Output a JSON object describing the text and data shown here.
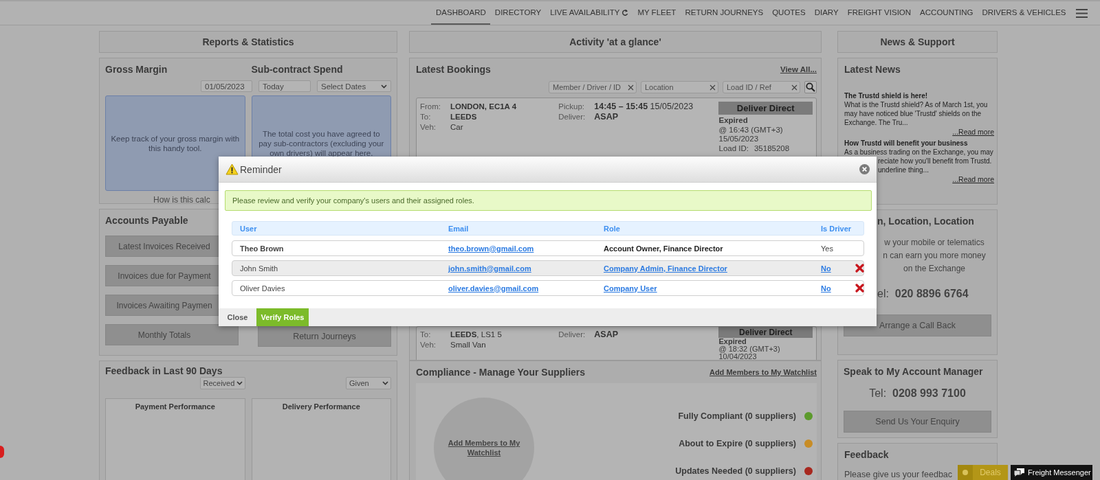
{
  "nav": {
    "items": [
      {
        "label": "DASHBOARD",
        "selected": true
      },
      {
        "label": "DIRECTORY",
        "selected": false
      },
      {
        "label": "LIVE AVAILABILITY",
        "selected": false,
        "kind": "refresh"
      },
      {
        "label": "MY FLEET",
        "selected": false
      },
      {
        "label": "RETURN JOURNEYS",
        "selected": false
      },
      {
        "label": "QUOTES",
        "selected": false
      },
      {
        "label": "DIARY",
        "selected": false
      },
      {
        "label": "FREIGHT VISION",
        "selected": false
      },
      {
        "label": "ACCOUNTING",
        "selected": false
      },
      {
        "label": "DRIVERS & VEHICLES",
        "selected": false
      }
    ]
  },
  "reports": {
    "header": "Reports & Statistics",
    "gross_margin": {
      "title": "Gross Margin",
      "date": "01/05/2023",
      "info": "Keep track of your gross margin with this handy tool.",
      "link": "How is this calc"
    },
    "subcontract": {
      "title": "Sub-contract Spend",
      "date_to": "Today",
      "range": "Select Dates",
      "info": "The total cost you have agreed to pay sub-contractors (excluding your own drivers) will appear here."
    }
  },
  "accounts_payable": {
    "title": "Accounts Payable",
    "left_buttons": [
      "Latest Invoices Received",
      "Invoices due for Payment",
      "Invoices Awaiting Paymen",
      "Monthly Totals"
    ],
    "right_buttons": [
      "Return Journeys"
    ]
  },
  "feedback_stats": {
    "title": "Feedback in Last 90 Days",
    "filters": [
      "Received",
      "Given"
    ],
    "charts": [
      "Payment Performance",
      "Delivery Performance"
    ]
  },
  "activity": {
    "header": "Activity 'at a glance'",
    "bookings": {
      "title": "Latest Bookings",
      "view_all": "View All...",
      "filters": [
        {
          "placeholder": "Member / Driver / ID"
        },
        {
          "placeholder": "Location"
        },
        {
          "placeholder": "Load ID / Ref"
        }
      ],
      "cards": [
        {
          "left": [
            {
              "label": "From:",
              "value": "LONDON, EC1A 4",
              "bold": true
            },
            {
              "label": "To:",
              "value": "LEEDS",
              "bold": true
            },
            {
              "label": "Veh:",
              "value": "Car",
              "bold": false
            }
          ],
          "middle": [
            {
              "label": "Pickup:",
              "value": "**14:45 – 15:45** 15/05/2023",
              "bold": false
            },
            {
              "label": "Deliver:",
              "value": "ASAP",
              "bold": true
            }
          ],
          "service": "Deliver Direct",
          "status": "Expired",
          "expiry": "@ 16:43  (GMT+3)",
          "expiry_date": "15/05/2023",
          "load_label": "Load ID:",
          "load_id": "35185208"
        },
        {
          "left": [
            {
              "label": "To:",
              "value": "**LEEDS**, LS1 5",
              "bold": false
            },
            {
              "label": "Veh:",
              "value": "Small Van",
              "bold": false
            }
          ],
          "middle": [
            {
              "label": "Deliver:",
              "value": "ASAP",
              "bold": true
            }
          ],
          "service": "Deliver Direct",
          "status": "Expired",
          "expiry": "@ 18:32  (GMT+3)",
          "expiry_date": "10/04/2023"
        }
      ]
    }
  },
  "compliance": {
    "title": "Compliance - Manage Your Suppliers",
    "link": "Add Members to My Watchlist",
    "circle_link": "Add Members to My Watchlist",
    "statuses": [
      {
        "label": "Fully Compliant (0 suppliers)",
        "color": "#5c9a2c"
      },
      {
        "label": "About to Expire (0 suppliers)",
        "color": "#c88d26"
      },
      {
        "label": "Updates Needed (0 suppliers)",
        "color": "#a8281f"
      }
    ]
  },
  "news": {
    "header": "News & Support",
    "title": "Latest News",
    "items": [
      {
        "title": "The Trustd shield is here!",
        "lines": [
          "What is the Trustd shield?  As of March 1st, you",
          "may have noticed blue 'Trustd' shields on the",
          "Exchange. The Tru..."
        ],
        "read_more": "...Read more"
      },
      {
        "title": "How Trustd will benefit your business",
        "lines": [
          "As a business trading on the Exchange, you may"
        ],
        "partial_lines": [
          "reciate how you'll benefit from Trustd.",
          "underline thing..."
        ],
        "read_more": "...Read more"
      }
    ]
  },
  "location": {
    "title": "n, Location, Location",
    "lines": [
      "w your mobile or telematics",
      "n can earn you more money",
      "on the Exchange"
    ],
    "tel": "el:  **020 8896 6764**",
    "button": "Arrange a Call Back"
  },
  "account_manager": {
    "title": "Speak to My Account Manager",
    "tel": "Tel:  **0208 993 7100**",
    "button": "Send Us Your Enquiry"
  },
  "feedback": {
    "title": "Feedback",
    "text": "Please give us your feedbac"
  },
  "widgets": {
    "deals": "Deals",
    "messenger": "Freight Messenger"
  },
  "modal": {
    "title": "Reminder",
    "message": "Please review and verify your company's users and their assigned roles.",
    "columns": [
      "User",
      "Email",
      "Role",
      "Is Driver"
    ],
    "rows": [
      {
        "user": "Theo Brown",
        "email": "theo.brown@gmail.com",
        "role": "Account Owner, Finance Director",
        "is_driver": "Yes",
        "editable": false,
        "highlighted": false
      },
      {
        "user": "John Smith",
        "email": "john.smith@gmail.com",
        "role": "Company Admin, Finance Director",
        "is_driver": "No",
        "editable": true,
        "highlighted": true
      },
      {
        "user": "Oliver Davies",
        "email": "oliver.davies@gmail.com",
        "role": "Company User",
        "is_driver": "No",
        "editable": true,
        "highlighted": false
      }
    ],
    "buttons": {
      "close": "Close",
      "verify": "Verify Roles"
    }
  }
}
